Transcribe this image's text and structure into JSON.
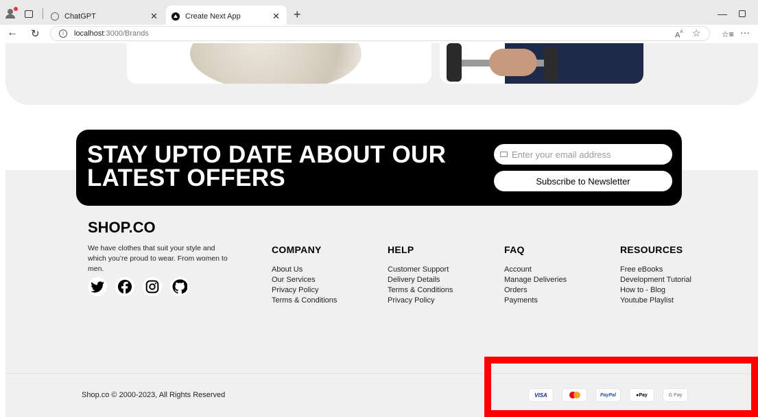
{
  "browser": {
    "tabs": [
      {
        "title": "ChatGPT"
      },
      {
        "title": "Create Next App"
      }
    ],
    "url_host": "localhost",
    "url_path": ":3000/Brands"
  },
  "newsletter": {
    "title": "STAY UPTO DATE ABOUT OUR LATEST OFFERS",
    "email_placeholder": "Enter your email address",
    "subscribe_label": "Subscribe to Newsletter"
  },
  "footer": {
    "brand": "SHOP.CO",
    "description": "We have clothes that suit your style and which you’re proud to wear. From women to men.",
    "socials": [
      "twitter-icon",
      "facebook-icon",
      "instagram-icon",
      "github-icon"
    ],
    "columns": [
      {
        "title": "COMPANY",
        "links": [
          "About Us",
          "Our Services",
          "Privacy Policy",
          "Terms & Conditions"
        ]
      },
      {
        "title": "HELP",
        "links": [
          "Customer Support",
          "Delivery Details",
          "Terms & Conditions",
          "Privacy Policy"
        ]
      },
      {
        "title": "FAQ",
        "links": [
          "Account",
          "Manage Deliveries",
          "Orders",
          "Payments"
        ]
      },
      {
        "title": "RESOURCES",
        "links": [
          "Free eBooks",
          "Development Tutorial",
          "How to - Blog",
          "Youtube Playlist"
        ]
      }
    ],
    "copyright": "Shop.co © 2000-2023, All Rights Reserved",
    "payments": {
      "visa": "VISA",
      "paypal": "PayPal",
      "applepay": "Pay",
      "googlepay": "G Pay"
    }
  },
  "colors": {
    "highlight": "#ff0000",
    "newsletter_bg": "#000000",
    "footer_bg": "#f0f0f0"
  }
}
